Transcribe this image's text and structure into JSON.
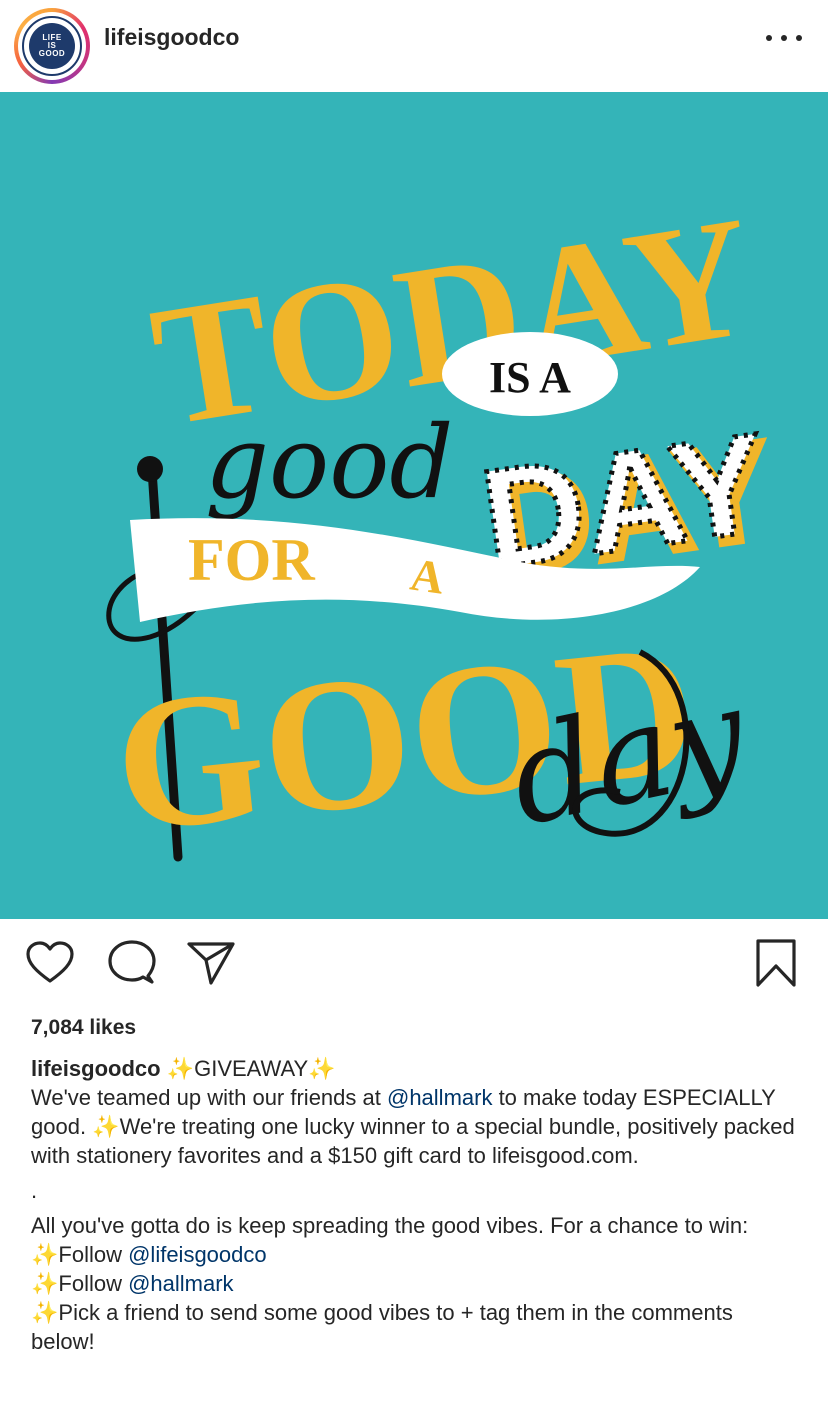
{
  "header": {
    "username": "lifeisgoodco",
    "avatar_text": [
      "LIFE",
      "IS",
      "GOOD"
    ],
    "more_icon": "more-horizontal-icon"
  },
  "post_image": {
    "words": {
      "today": "TODAY",
      "is_a": "IS A",
      "good_script": "good",
      "day_big": "DAY",
      "for_a_1": "FOR",
      "for_a_2": "A",
      "good_big": "GOOD",
      "day_script": "day"
    },
    "colors": {
      "background": "#34b4b8",
      "yellow": "#f0b52a",
      "white": "#ffffff",
      "black": "#111111"
    }
  },
  "actions": {
    "like_icon": "heart-icon",
    "comment_icon": "comment-icon",
    "share_icon": "send-icon",
    "save_icon": "bookmark-icon"
  },
  "likes": "7,084 likes",
  "caption": {
    "username": "lifeisgoodco",
    "sparkle": "✨",
    "giveaway": "GIVEAWAY",
    "line1_pre": "We've teamed up with our friends at ",
    "line1_mention": "@hallmark",
    "line1_post": " to make today ESPECIALLY good. ",
    "line1_rest": "We're treating one lucky winner to a special bundle, positively packed with stationery favorites and a $150 gift card to lifeisgood.com.",
    "dot": ".",
    "para2": "All you've gotta do is keep spreading the good vibes. For a chance to win:",
    "follow": "Follow ",
    "mention_life": "@lifeisgoodco",
    "mention_hallmark": "@hallmark",
    "pick": "Pick a friend to send some good vibes to + tag them in the comments below!"
  }
}
